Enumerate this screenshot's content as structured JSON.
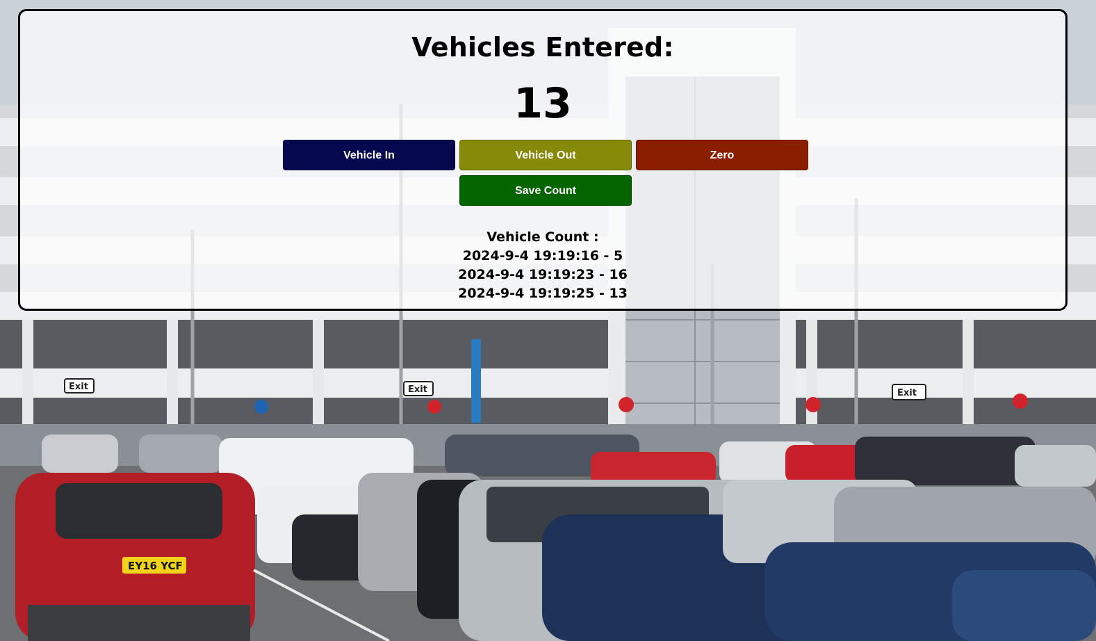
{
  "counter": {
    "title": "Vehicles Entered:",
    "value": "13"
  },
  "buttons": {
    "vehicle_in": "Vehicle In",
    "vehicle_out": "Vehicle Out",
    "zero": "Zero",
    "save_count": "Save Count"
  },
  "colors": {
    "vehicle_in": "#05084f",
    "vehicle_out": "#878a06",
    "zero": "#8b1d00",
    "save_count": "#046400"
  },
  "log": {
    "heading": "Vehicle Count :",
    "entries": [
      "2024-9-4 19:19:16 - 5",
      "2024-9-4 19:19:23 - 16",
      "2024-9-4 19:19:25 - 13"
    ]
  },
  "background": {
    "exit_signs": [
      "Exit",
      "Exit",
      "Exit"
    ],
    "license_plate": "EY16 YCF"
  }
}
